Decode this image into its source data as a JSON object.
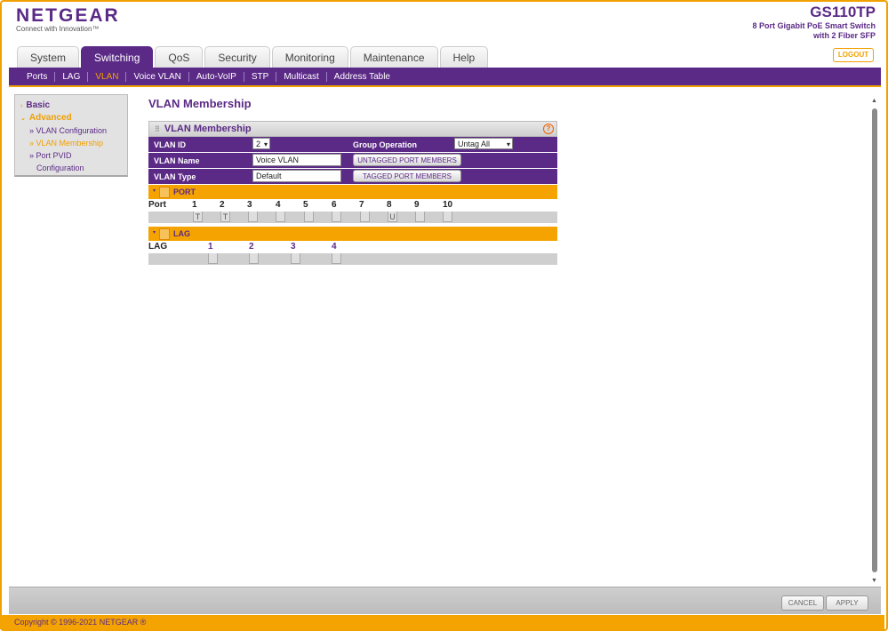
{
  "header": {
    "brand": "NETGEAR",
    "tagline": "Connect with Innovation™",
    "model": "GS110TP",
    "model_desc": "8 Port Gigabit PoE Smart Switch with 2 Fiber SFP",
    "logout": "LOGOUT"
  },
  "tabs": [
    {
      "label": "System"
    },
    {
      "label": "Switching",
      "active": true
    },
    {
      "label": "QoS"
    },
    {
      "label": "Security"
    },
    {
      "label": "Monitoring"
    },
    {
      "label": "Maintenance"
    },
    {
      "label": "Help"
    }
  ],
  "subnav": [
    {
      "label": "Ports"
    },
    {
      "label": "LAG"
    },
    {
      "label": "VLAN",
      "active": true
    },
    {
      "label": "Voice VLAN"
    },
    {
      "label": "Auto-VoIP"
    },
    {
      "label": "STP"
    },
    {
      "label": "Multicast"
    },
    {
      "label": "Address Table"
    }
  ],
  "sidebar": {
    "basic": "Basic",
    "advanced": "Advanced",
    "links": [
      {
        "label": "» VLAN Configuration"
      },
      {
        "label": "» VLAN Membership",
        "active": true
      },
      {
        "label": "» Port PVID"
      },
      {
        "label": "Configuration"
      }
    ]
  },
  "page_title": "VLAN Membership",
  "panel": {
    "title": "VLAN Membership",
    "help": "?",
    "vlan_id_label": "VLAN ID",
    "vlan_id_value": "2",
    "group_op_label": "Group Operation",
    "group_op_value": "Untag All",
    "vlan_name_label": "VLAN Name",
    "vlan_name_value": "Voice VLAN",
    "untagged_btn": "UNTAGGED PORT MEMBERS",
    "vlan_type_label": "VLAN Type",
    "vlan_type_value": "Default",
    "tagged_btn": "TAGGED PORT MEMBERS",
    "port_section": "PORT",
    "port_label": "Port",
    "ports": [
      "1",
      "2",
      "3",
      "4",
      "5",
      "6",
      "7",
      "8",
      "9",
      "10"
    ],
    "port_states": [
      "T",
      "T",
      "",
      "",
      "",
      "",
      "",
      "U",
      "",
      ""
    ],
    "lag_section": "LAG",
    "lag_label": "LAG",
    "lags": [
      "1",
      "2",
      "3",
      "4"
    ],
    "lag_states": [
      "",
      "",
      "",
      ""
    ]
  },
  "footer": {
    "cancel": "CANCEL",
    "apply": "APPLY",
    "copyright": "Copyright © 1996-2021 NETGEAR ®"
  },
  "colors": {
    "purple": "#5b2a86",
    "orange": "#f5a300"
  }
}
